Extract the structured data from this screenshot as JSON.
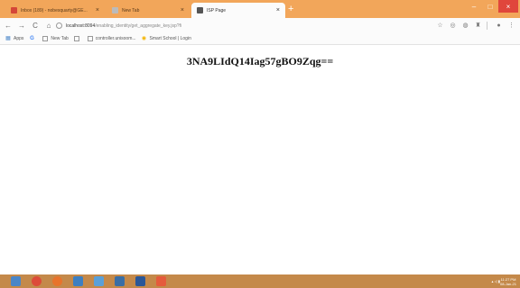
{
  "tabs": [
    {
      "label": "Inbox (189) - nobesquarty@GE...",
      "close": "×",
      "favicon_color": "#d44638",
      "active": false
    },
    {
      "label": "New Tab",
      "close": "×",
      "favicon_color": "#bbbbbb",
      "active": false
    },
    {
      "label": "ISP Page",
      "close": "×",
      "favicon_color": "#555555",
      "active": true
    }
  ],
  "window_controls": {
    "minimize": "–",
    "maximize": "□",
    "close": "×"
  },
  "toolbar": {
    "back": "←",
    "forward": "→",
    "reload": "C",
    "home": "⌂",
    "url_host": "localhost:8094",
    "url_path": "/enabling_identity/get_aggregate_key.jsp?fi",
    "star": "☆",
    "menu": "⋮"
  },
  "bookmarks": [
    {
      "label": "Apps",
      "icon": "apps-icon"
    },
    {
      "label": "G",
      "icon": "google-icon"
    },
    {
      "label": "New Tab",
      "icon": "page-icon"
    },
    {
      "label": "",
      "icon": "page-icon"
    },
    {
      "label": "controller.unisoom...",
      "icon": "page-icon"
    },
    {
      "label": "Smart School | Login",
      "icon": "smart-school-icon"
    }
  ],
  "main": {
    "token_text": "3NA9LIdQ14Iag57gBO9Zqg=="
  },
  "taskbar": {
    "apps": [
      {
        "name": "start",
        "color": "#4a86c8"
      },
      {
        "name": "chrome",
        "color": "#dd4b39"
      },
      {
        "name": "firefox",
        "color": "#e8732c"
      },
      {
        "name": "netbeans",
        "color": "#3d7fc1"
      },
      {
        "name": "explorer",
        "color": "#5aa0d8"
      },
      {
        "name": "photos",
        "color": "#3a6ea5"
      },
      {
        "name": "word",
        "color": "#2b5797"
      },
      {
        "name": "app",
        "color": "#e55b3c"
      }
    ],
    "tray_icons": "▴ ◁ ▮",
    "clock_time": "11:27 PM",
    "clock_date": "08-Jan-21"
  },
  "colors": {
    "tabstrip": "#f2a65a",
    "taskbar": "#c4894a",
    "close_button": "#e0463c"
  }
}
